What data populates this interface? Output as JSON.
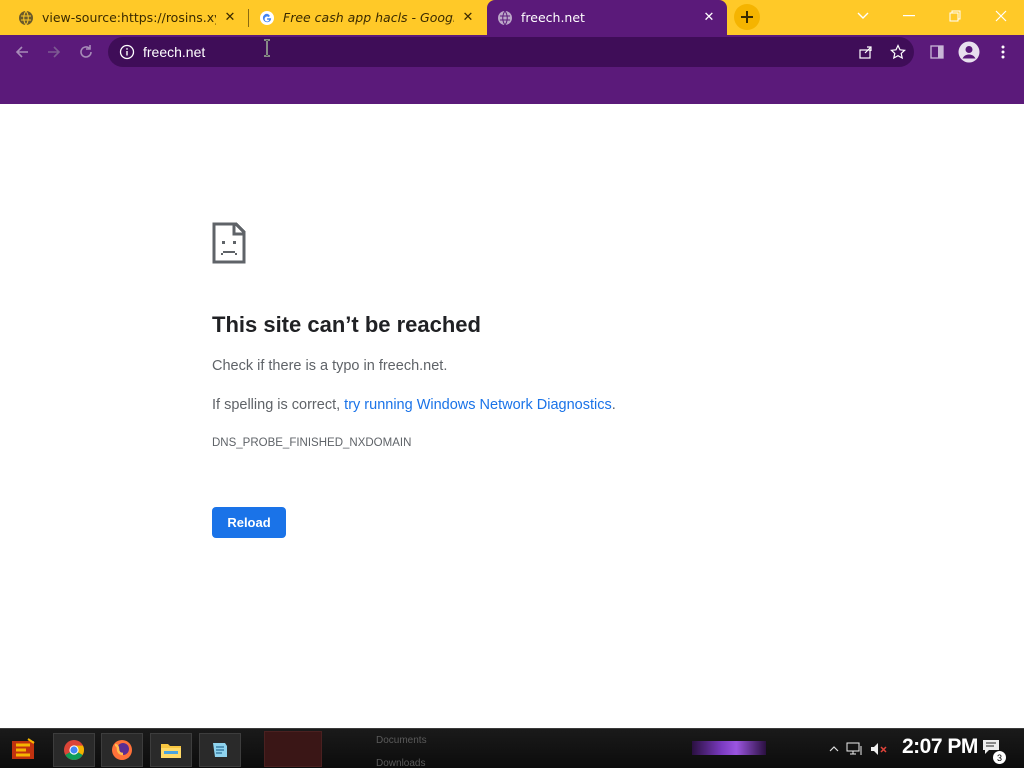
{
  "browser": {
    "tabs": [
      {
        "title": "view-source:https://rosins.xyz",
        "favicon": "globe-icon",
        "active": false
      },
      {
        "title": "Free cash app hacls - Google Search",
        "favicon": "google-icon",
        "active": false
      },
      {
        "title": "freech.net",
        "favicon": "globe-icon",
        "active": true
      }
    ],
    "url": "freech.net",
    "colors": {
      "tabstrip": "#ffc928",
      "frame": "#5b1a7a",
      "omnibox": "#3f0d58"
    }
  },
  "error_page": {
    "title": "This site can’t be reached",
    "line1": "Check if there is a typo in freech.net.",
    "line2_prefix": "If spelling is correct, ",
    "line2_link": "try running Windows Network Diagnostics",
    "line2_suffix": ".",
    "error_code": "DNS_PROBE_FINISHED_NXDOMAIN",
    "reload_label": "Reload",
    "accent_color": "#1a73e8"
  },
  "taskbar": {
    "apps": [
      "start-icon",
      "chrome-icon",
      "firefox-icon",
      "file-explorer-icon",
      "notepad-icon"
    ],
    "background_items": [
      "Documents",
      "Downloads"
    ],
    "clock": "2:07 PM",
    "notification_count": "3"
  }
}
